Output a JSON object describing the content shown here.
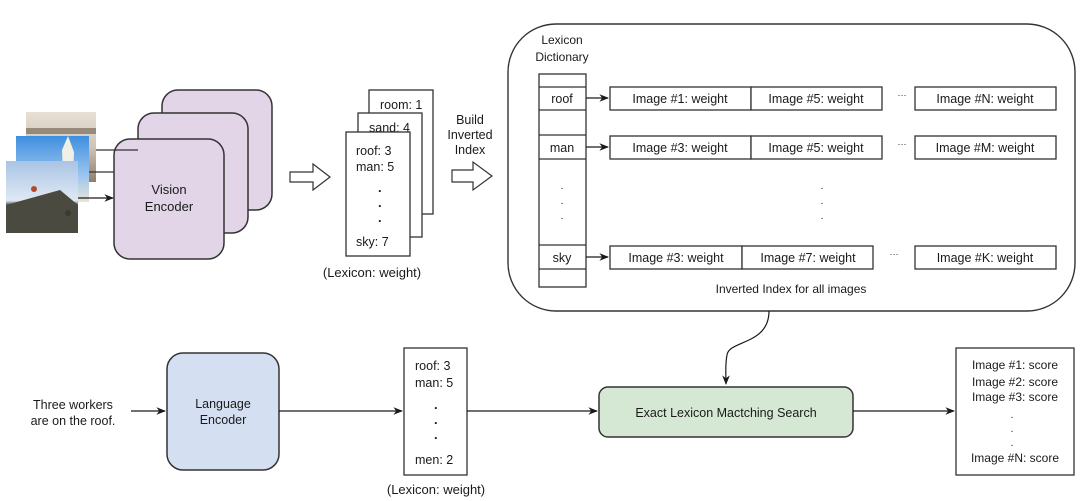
{
  "colors": {
    "vision_encoder_fill": "#e1d5e7",
    "language_encoder_fill": "#d4e0f1",
    "search_fill": "#d5e8d4",
    "stroke": "#333333"
  },
  "vision": {
    "encoder_line1": "Vision",
    "encoder_line2": "Encoder"
  },
  "image_lexicons": {
    "back_card": "room: 1",
    "middle_card": "sand: 4",
    "front_card": {
      "line1": "roof: 3",
      "line2": "man: 5",
      "dots": ".",
      "last": "sky: 7"
    },
    "caption": "(Lexicon: weight)"
  },
  "build_index": {
    "line1": "Build",
    "line2": "Inverted",
    "line3": "Index"
  },
  "inverted_index": {
    "dictionary_title1": "Lexicon",
    "dictionary_title2": "Dictionary",
    "rows": [
      {
        "term": "roof",
        "postings": [
          "Image #1: weight",
          "Image #5: weight"
        ],
        "last": "Image #N: weight"
      },
      {
        "term": "man",
        "postings": [
          "Image #3: weight",
          "Image #5: weight"
        ],
        "last": "Image #M: weight"
      },
      {
        "term": "sky",
        "postings": [
          "Image #3: weight",
          "Image #7: weight"
        ],
        "last": "Image #K: weight"
      }
    ],
    "ellipsis": "···",
    "dot": ".",
    "caption": "Inverted Index for all images"
  },
  "query": {
    "line1": "Three workers",
    "line2": "are on the roof.",
    "encoder_line1": "Language",
    "encoder_line2": "Encoder",
    "lexicon": {
      "line1": "roof: 3",
      "line2": "man: 5",
      "dot": ".",
      "last": "men: 2"
    },
    "caption": "(Lexicon: weight)"
  },
  "search": {
    "label": "Exact Lexicon Mactching Search"
  },
  "results": {
    "items": [
      "Image #1: score",
      "Image #2: score",
      "Image #3: score"
    ],
    "dot": ".",
    "last": "Image #N: score"
  }
}
